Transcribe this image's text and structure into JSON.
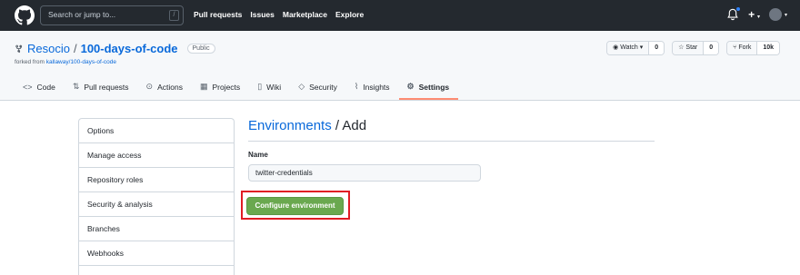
{
  "header": {
    "search_placeholder": "Search or jump to...",
    "slash_key": "/",
    "nav": [
      "Pull requests",
      "Issues",
      "Marketplace",
      "Explore"
    ]
  },
  "repo": {
    "owner": "Resocio",
    "separator": "/",
    "name": "100-days-of-code",
    "visibility": "Public",
    "forked_prefix": "forked from ",
    "forked_from": "kallaway/100-days-of-code",
    "watch": {
      "label": "Watch",
      "count": "0"
    },
    "star": {
      "label": "Star",
      "count": "0"
    },
    "fork": {
      "label": "Fork",
      "count": "10k"
    }
  },
  "tabs": [
    {
      "label": "Code",
      "icon": "code-icon"
    },
    {
      "label": "Pull requests",
      "icon": "pull-request-icon"
    },
    {
      "label": "Actions",
      "icon": "play-icon"
    },
    {
      "label": "Projects",
      "icon": "table-icon"
    },
    {
      "label": "Wiki",
      "icon": "book-icon"
    },
    {
      "label": "Security",
      "icon": "shield-icon"
    },
    {
      "label": "Insights",
      "icon": "graph-icon"
    },
    {
      "label": "Settings",
      "icon": "gear-icon"
    }
  ],
  "sidebar": {
    "items": [
      "Options",
      "Manage access",
      "Repository roles",
      "Security & analysis",
      "Branches",
      "Webhooks",
      ""
    ]
  },
  "main": {
    "breadcrumb": "Environments",
    "title_sep": " / ",
    "title": "Add",
    "name_label": "Name",
    "name_value": "twitter-credentials",
    "configure_button": "Configure environment"
  },
  "colors": {
    "header_bg": "#24292f",
    "link": "#0969da",
    "button_green": "#6aa84f",
    "highlight_red": "#e01b24",
    "active_tab_underline": "#fd8c73"
  }
}
